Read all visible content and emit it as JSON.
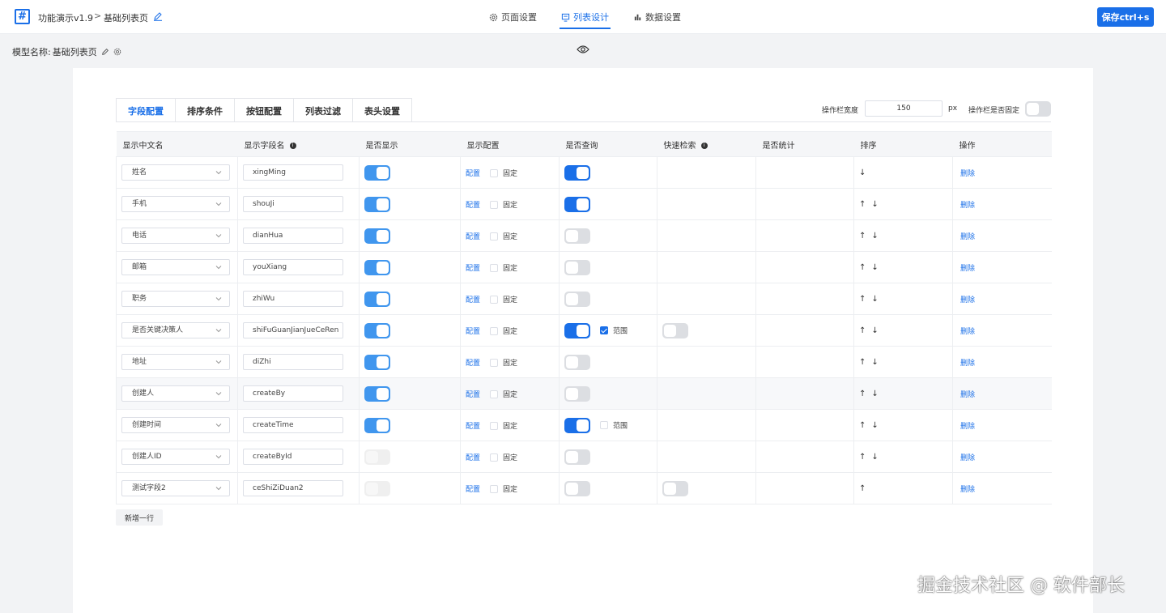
{
  "header": {
    "app_title": "功能演示v1.9",
    "separator": ">",
    "page_name": "基础列表页",
    "tabs": [
      {
        "label": "页面设置",
        "icon": "gear-icon",
        "active": false
      },
      {
        "label": "列表设计",
        "icon": "list-design-icon",
        "active": true
      },
      {
        "label": "数据设置",
        "icon": "bar-chart-icon",
        "active": false
      }
    ],
    "save_label": "保存ctrl+s"
  },
  "model": {
    "label": "模型名称:",
    "value": "基础列表页"
  },
  "sub_tabs": [
    "字段配置",
    "排序条件",
    "按钮配置",
    "列表过滤",
    "表头设置"
  ],
  "op_bar": {
    "width_label": "操作栏宽度",
    "width_value": "150",
    "width_unit": "px",
    "fixed_label": "操作栏是否固定",
    "fixed": false
  },
  "table": {
    "headers": [
      "显示中文名",
      "显示字段名",
      "是否显示",
      "显示配置",
      "是否查询",
      "快速检索",
      "是否统计",
      "排序",
      "操作"
    ],
    "config_label": "配置",
    "fixed_label": "固定",
    "range_label": "范围",
    "delete_label": "删除",
    "rows": [
      {
        "cn": "姓名",
        "field": "xingMing",
        "show": "on",
        "query": "on",
        "range": null,
        "quick": null,
        "up": false,
        "down": true
      },
      {
        "cn": "手机",
        "field": "shouJi",
        "show": "on",
        "query": "on",
        "range": null,
        "quick": null,
        "up": true,
        "down": true
      },
      {
        "cn": "电话",
        "field": "dianHua",
        "show": "on",
        "query": "off",
        "range": null,
        "quick": null,
        "up": true,
        "down": true
      },
      {
        "cn": "邮箱",
        "field": "youXiang",
        "show": "on",
        "query": "off",
        "range": null,
        "quick": null,
        "up": true,
        "down": true
      },
      {
        "cn": "职务",
        "field": "zhiWu",
        "show": "on",
        "query": "off",
        "range": null,
        "quick": null,
        "up": true,
        "down": true
      },
      {
        "cn": "是否关键决策人",
        "field": "shiFuGuanJianJueCeRen",
        "show": "on",
        "query": "on",
        "range": true,
        "quick": "off",
        "up": true,
        "down": true
      },
      {
        "cn": "地址",
        "field": "diZhi",
        "show": "on",
        "query": "off",
        "range": null,
        "quick": null,
        "up": true,
        "down": true
      },
      {
        "cn": "创建人",
        "field": "createBy",
        "show": "on",
        "query": "off",
        "range": null,
        "quick": null,
        "up": true,
        "down": true
      },
      {
        "cn": "创建时间",
        "field": "createTime",
        "show": "on",
        "query": "on",
        "range": false,
        "quick": null,
        "up": true,
        "down": true
      },
      {
        "cn": "创建人ID",
        "field": "createById",
        "show": "disabled",
        "query": "off",
        "range": null,
        "quick": null,
        "up": true,
        "down": true
      },
      {
        "cn": "测试字段2",
        "field": "ceShiZiDuan2",
        "show": "disabled",
        "query": "off",
        "range": null,
        "quick": "off",
        "up": true,
        "down": false
      }
    ]
  },
  "add_row_label": "新增一行",
  "watermark": "掘金技术社区 @ 软件部长",
  "colors": {
    "accent": "#1a6fe8",
    "toggle_on": "#4096ee"
  }
}
